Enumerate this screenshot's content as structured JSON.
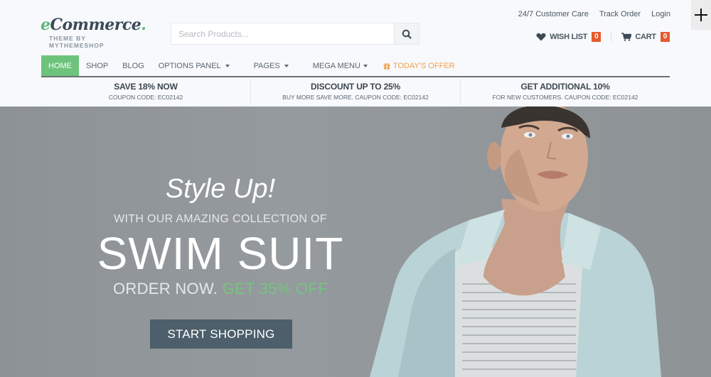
{
  "header": {
    "logo": {
      "prefix": "e",
      "main": "Commerce",
      "dot": ".",
      "tagline": "THEME BY MYTHEMESHOP"
    },
    "search": {
      "placeholder": "Search Products...",
      "value": "",
      "icon": "search-icon"
    },
    "top_links": [
      "24/7 Customer Care",
      "Track Order",
      "Login"
    ],
    "wishlist": {
      "label": "WISH LIST",
      "count": "0",
      "icon": "heart-icon"
    },
    "cart": {
      "label": "CART",
      "count": "0",
      "icon": "cart-icon"
    },
    "corner_button": {
      "icon": "plus-icon"
    }
  },
  "nav": {
    "items": [
      {
        "label": "HOME",
        "active": true
      },
      {
        "label": "SHOP"
      },
      {
        "label": "BLOG"
      },
      {
        "label": "OPTIONS PANEL",
        "dropdown": true
      },
      {
        "label": "PAGES",
        "dropdown": true
      },
      {
        "label": "MEGA MENU",
        "dropdown": true
      },
      {
        "label": "TODAY'S OFFER",
        "icon": "gift-icon"
      }
    ]
  },
  "promos": [
    {
      "title": "SAVE 18% NOW",
      "subtitle": "COUPON CODE: EC02142"
    },
    {
      "title": "DISCOUNT UP TO 25%",
      "subtitle": "BUY MORE SAVE MORE. CAUPON CODE: EC02142"
    },
    {
      "title": "GET ADDITIONAL 10%",
      "subtitle": "FOR NEW CUSTOMERS. CAUPON CODE: EC02142"
    }
  ],
  "hero": {
    "script": "Style Up!",
    "line": "WITH OUR AMAZING COLLECTION OF",
    "headline": "SWIM SUIT",
    "order": "ORDER NOW.",
    "offer": "GET 35% OFF",
    "cta": "START SHOPPING"
  },
  "colors": {
    "accent_green": "#6dc37c",
    "badge_orange": "#e55b2d",
    "offer_orange": "#f0a04b",
    "cta_bg": "#4c5f6b"
  }
}
